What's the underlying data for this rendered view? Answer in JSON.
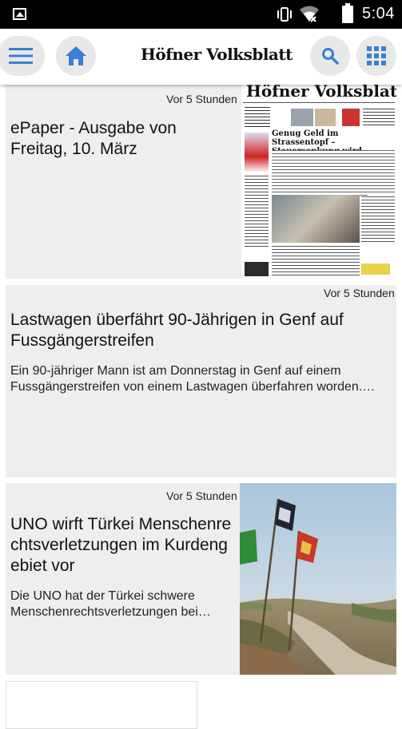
{
  "status_bar": {
    "time": "5:04"
  },
  "toolbar": {
    "logo_text": "Höfner Volksblatt",
    "menu_icon": "menu-icon",
    "home_icon": "home-icon",
    "search_icon": "search-icon",
    "apps_icon": "apps-grid-icon",
    "accent_color": "#3b7fd4"
  },
  "articles": [
    {
      "time": "Vor 5 Stunden",
      "title": "ePaper - Ausgabe von Freitag, 10. März"
    },
    {
      "time": "Vor 5 Stunden",
      "title": "Lastwagen überfährt 90-Jährigen in Genf auf Fussgängerstreifen",
      "teaser": "Ein 90-jähriger Mann ist am Donnerstag in Genf auf einem Fussgängerstreifen von einem Lastwagen überfahren worden.…"
    },
    {
      "time": "Vor 5 Stunden",
      "title": "UNO wirft Türkei Menschenrechtsverletzungen im Kurdengebiet vor",
      "teaser": "Die UNO hat der Türkei schwere Menschenrechtsverletzungen bei…"
    }
  ],
  "epaper_thumb": {
    "masthead": "Höfner Volksblatt",
    "headline": "Genug Geld im Strassentopf – Steuersenkung wird diskutiert"
  }
}
